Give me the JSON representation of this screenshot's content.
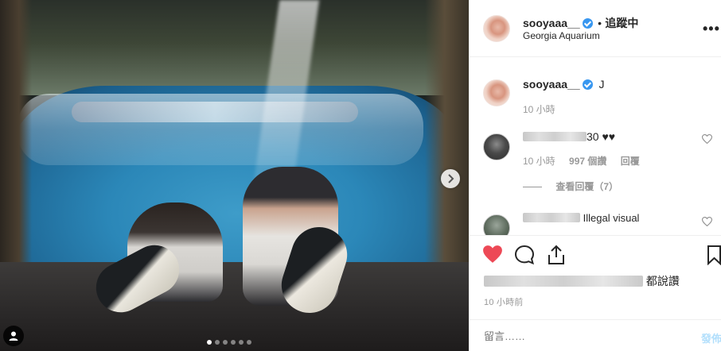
{
  "post": {
    "author": "sooyaaa__",
    "follow_separator": "•",
    "follow_status": "追蹤中",
    "location": "Georgia Aquarium",
    "caption_user": "sooyaaa__",
    "caption_text": "J",
    "caption_time": "10 小時",
    "more_icon": "more-horizontal-icon"
  },
  "comments": [
    {
      "username_suffix": "30 ♥♥",
      "time": "10 小時",
      "likes": "997 個讚",
      "reply_label": "回覆",
      "view_replies": "查看回覆（7）"
    },
    {
      "text": "Illegal visual"
    }
  ],
  "actions": {
    "like_icon": "heart-filled-icon",
    "comment_icon": "comment-bubble-icon",
    "share_icon": "share-icon",
    "save_icon": "bookmark-icon",
    "like_color": "#ed4956"
  },
  "likes_text": "都說讚",
  "time_ago": "10 小時前",
  "comment_box": {
    "placeholder": "留言……",
    "post_label": "發佈"
  },
  "carousel": {
    "slides": 6,
    "active_index": 0
  }
}
